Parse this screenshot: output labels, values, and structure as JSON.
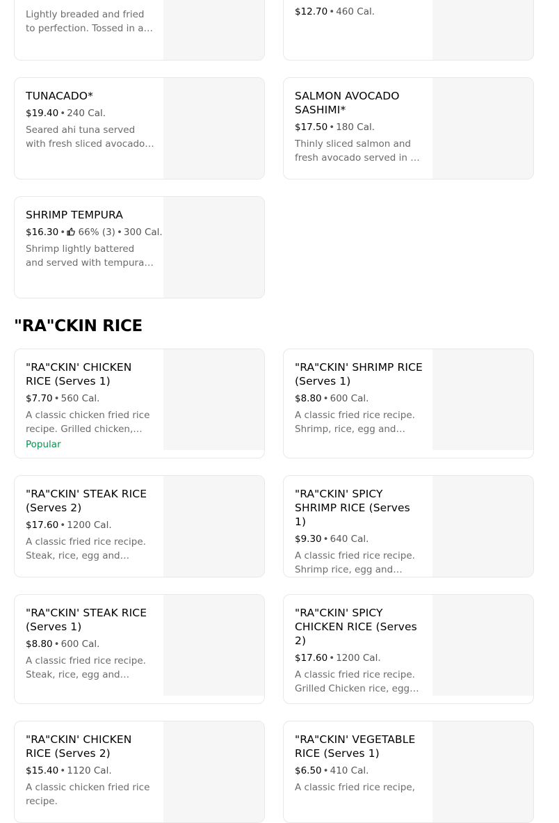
{
  "section_title": "\"RA\"CKIN RICE",
  "items": [
    {
      "name": "",
      "price": "",
      "cal": "",
      "desc": "Lightly breaded and fried to perfection. Tossed in a Spicy sauce",
      "badge": ""
    },
    {
      "name": "",
      "price": "$12.70",
      "cal": "460 Cal.",
      "desc": "",
      "badge": ""
    },
    {
      "name": "TUNACADO*",
      "price": "$19.40",
      "cal": "240 Cal.",
      "desc": "Seared ahi tuna served with fresh sliced avocado and ponzu sauce",
      "badge": ""
    },
    {
      "name": "SALMON AVOCADO SASHIMI*",
      "price": "$17.50",
      "cal": "180 Cal.",
      "desc": "Thinly sliced salmon and fresh avocado served in a ponzu sauce",
      "badge": ""
    },
    {
      "name": "SHRIMP TEMPURA",
      "price": "$16.30",
      "rating": "66% (3)",
      "cal": "300 Cal.",
      "desc": "Shrimp lightly battered and served with tempura dipping sauce",
      "badge": ""
    },
    {
      "name": "\"RA\"CKIN' CHICKEN RICE (Serves 1)",
      "price": "$7.70",
      "cal": "560 Cal.",
      "desc": "A classic chicken fried rice recipe. Grilled chicken, rice, egg and chopped vegetables",
      "badge": "Popular"
    },
    {
      "name": "\"RA\"CKIN' SHRIMP RICE (Serves 1)",
      "price": "$8.80",
      "cal": "600 Cal.",
      "desc": "A classic fried rice recipe. Shrimp, rice, egg and chopped vegetables",
      "badge": ""
    },
    {
      "name": "\"RA\"CKIN' STEAK RICE (Serves 2)",
      "price": "$17.60",
      "cal": "1200 Cal.",
      "desc": "A classic fried rice recipe. Steak, rice, egg and chopped vegetables",
      "badge": ""
    },
    {
      "name": "\"RA\"CKIN' SPICY SHRIMP RICE (Serves 1)",
      "price": "$9.30",
      "cal": "640 Cal.",
      "desc": "A classic fried rice recipe. Shrimp rice, egg and chopped vegetables",
      "badge": ""
    },
    {
      "name": "\"RA\"CKIN' STEAK RICE (Serves 1)",
      "price": "$8.80",
      "cal": "600 Cal.",
      "desc": "A classic fried rice recipe. Steak, rice, egg and chopped vegetables",
      "badge": ""
    },
    {
      "name": "\"RA\"CKIN' SPICY CHICKEN RICE (Serves 2)",
      "price": "$17.60",
      "cal": "1200 Cal.",
      "desc": "A classic fried rice recipe. Grilled Chicken rice, egg and chopped vegetables",
      "badge": ""
    },
    {
      "name": "\"RA\"CKIN' CHICKEN RICE (Serves 2)",
      "price": "$15.40",
      "cal": "1120 Cal.",
      "desc": "A classic chicken fried rice recipe.",
      "badge": ""
    },
    {
      "name": "\"RA\"CKIN' VEGETABLE RICE (Serves 1)",
      "price": "$6.50",
      "cal": "410 Cal.",
      "desc": "A classic fried rice recipe,",
      "badge": ""
    }
  ],
  "colors": {
    "popular": "#05944f",
    "image_placeholder": "#f6f6f6",
    "border": "#e8e8e8"
  },
  "icons": {
    "rating": "thumbs-up-icon"
  }
}
